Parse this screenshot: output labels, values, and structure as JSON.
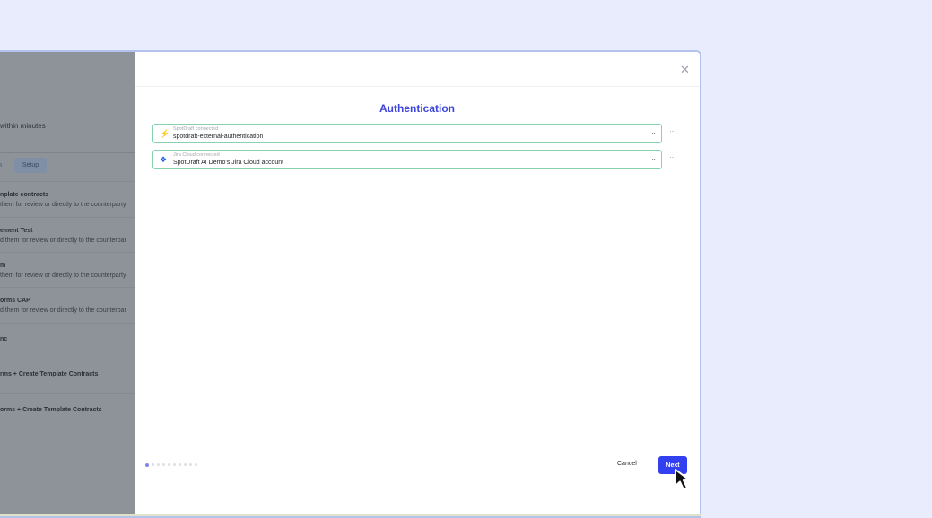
{
  "background_panel": {
    "subtitle": "within minutes",
    "tab_partial": "n",
    "setup_tab": "Setup",
    "items": [
      {
        "title": "nplate contracts",
        "desc": "them for review or directly to the counterparty"
      },
      {
        "title": "ement Test",
        "desc": "d them for review or directly to the counterpar"
      },
      {
        "title": "m",
        "desc": "them for review or directly to the counterparty"
      },
      {
        "title": "orms CAP",
        "desc": "d them for review or directly to the counterpar"
      },
      {
        "title": "nc",
        "desc": ""
      },
      {
        "title": "rms + Create Template Contracts",
        "desc": ""
      },
      {
        "title": "orms + Create Template Contracts",
        "desc": ""
      }
    ]
  },
  "modal": {
    "title": "Authentication",
    "close_icon": "close-icon",
    "connections": [
      {
        "label": "SpotDraft connected",
        "value": "spotdraft-external-authentication",
        "icon": "spotdraft-icon"
      },
      {
        "label": "Jira Cloud connected",
        "value": "SpotDraft AI Demo's Jira Cloud account",
        "icon": "jira-icon"
      }
    ],
    "more_label": "···",
    "steps_total": 10,
    "step_current": 1,
    "cancel_label": "Cancel",
    "next_label": "Next"
  },
  "colors": {
    "accent": "#3340ef",
    "title": "#3d45dc",
    "connected_border": "#86d2b0"
  }
}
